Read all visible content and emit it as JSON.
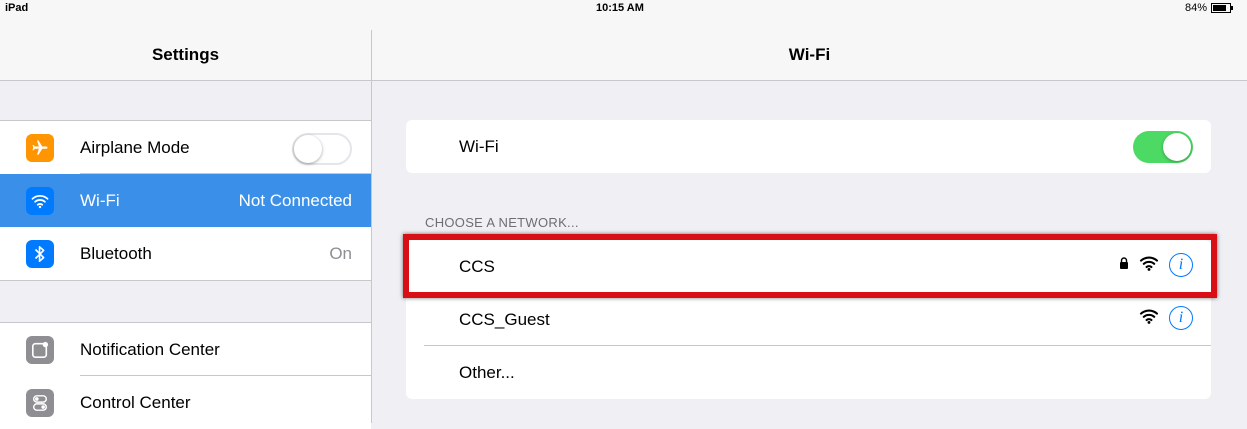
{
  "status_bar": {
    "device": "iPad",
    "time": "10:15 AM",
    "battery": "84%",
    "battery_level": 0.84
  },
  "sidebar": {
    "title": "Settings",
    "group1": [
      {
        "label": "Airplane Mode",
        "value": "",
        "icon": "airplane-icon",
        "icon_color": "#ff9500",
        "toggle": "off"
      },
      {
        "label": "Wi-Fi",
        "value": "Not Connected",
        "icon": "wifi-icon",
        "icon_color": "#007aff",
        "selected": true
      },
      {
        "label": "Bluetooth",
        "value": "On",
        "icon": "bluetooth-icon",
        "icon_color": "#007aff"
      }
    ],
    "group2": [
      {
        "label": "Notification Center",
        "icon": "notification-center-icon",
        "icon_color": "#8e8e93"
      },
      {
        "label": "Control Center",
        "icon": "control-center-icon",
        "icon_color": "#8e8e93"
      }
    ]
  },
  "main": {
    "title": "Wi-Fi",
    "wifi_toggle": {
      "label": "Wi-Fi",
      "state": "on"
    },
    "section_header": "CHOOSE A NETWORK...",
    "networks": [
      {
        "name": "CCS",
        "locked": true,
        "highlighted": true
      },
      {
        "name": "CCS_Guest",
        "locked": false
      },
      {
        "name": "Other..."
      }
    ]
  },
  "colors": {
    "accent": "#007aff",
    "toggle_on": "#4cd964",
    "selection": "#3a8fe8",
    "highlight_border": "#d80f14"
  }
}
